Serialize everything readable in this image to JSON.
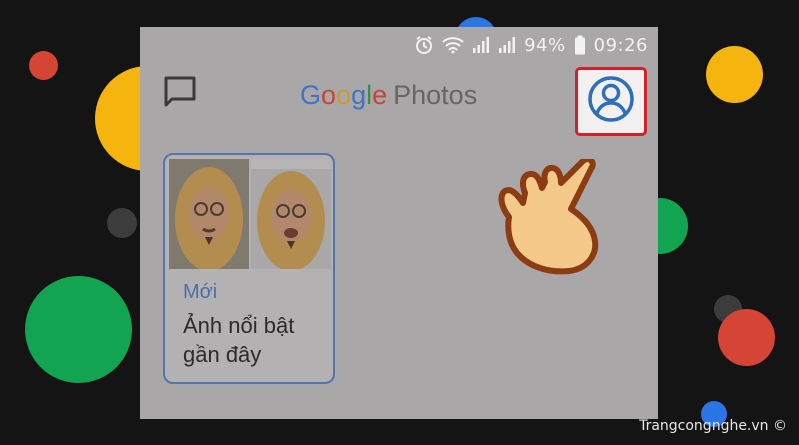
{
  "status_bar": {
    "battery_percent": "94%",
    "time": "09:26",
    "icons": [
      "alarm-icon",
      "wifi-icon",
      "signal-icon",
      "signal-icon",
      "battery-icon"
    ]
  },
  "app_bar": {
    "logo_google": [
      "G",
      "o",
      "o",
      "g",
      "l",
      "e"
    ],
    "logo_photos": "Photos",
    "left_icon": "chat-icon",
    "account_icon": "account-circle-icon"
  },
  "memory_card": {
    "tag": "Mới",
    "title": "Ảnh nổi bật gần đây"
  },
  "watermark": "Trangcongnghe.vn ©",
  "colors": {
    "background": "#141414",
    "highlight_border": "#d3202a",
    "account_blue": "#2f6fb8",
    "google_blue": "#3f73c4",
    "google_red": "#c74534",
    "google_yellow": "#cc9d2d",
    "google_green": "#3b8e4f"
  }
}
